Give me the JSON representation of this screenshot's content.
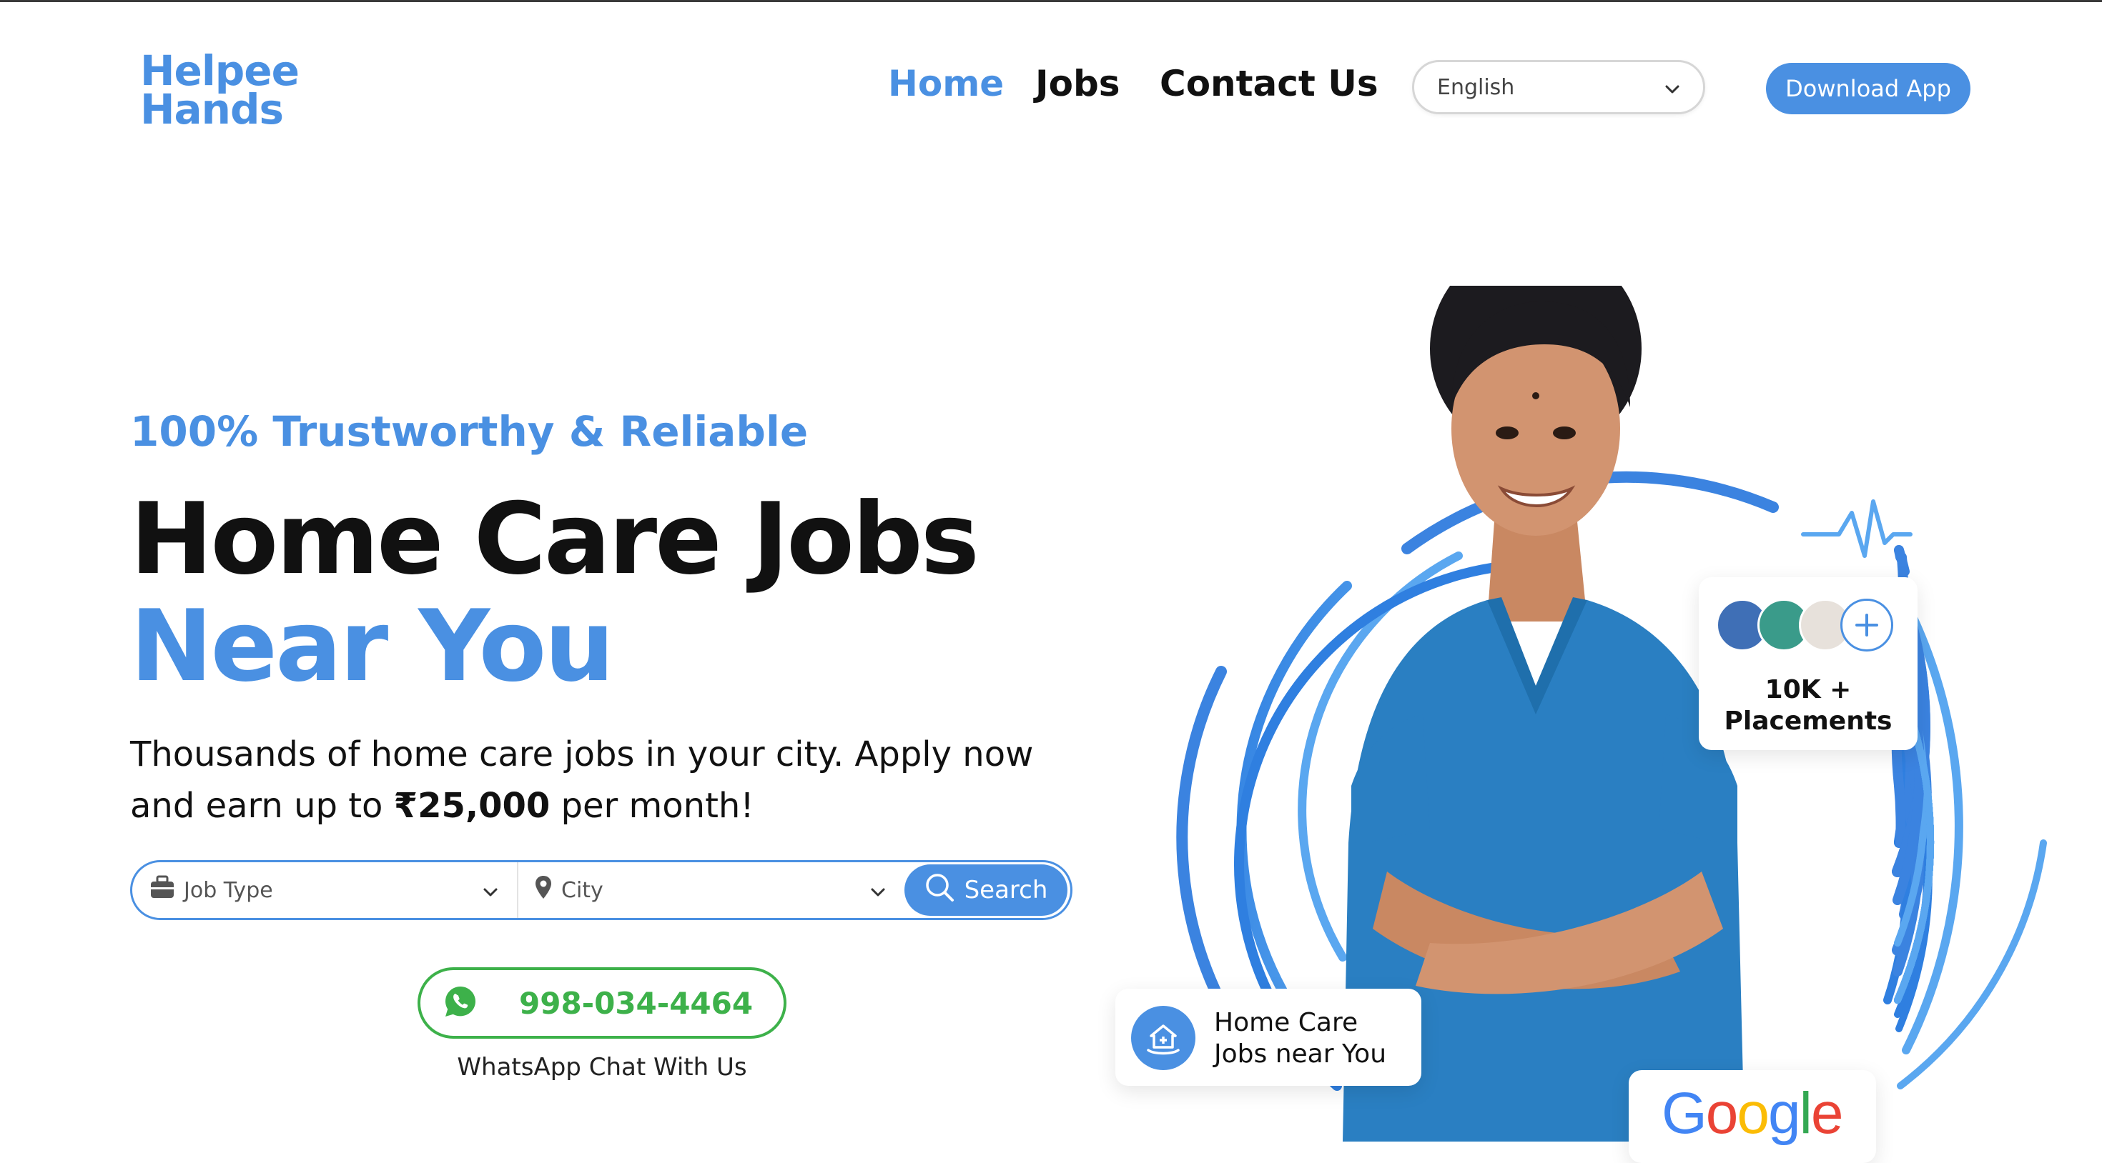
{
  "brand": {
    "line1": "Helpee",
    "line2": "Hands",
    "color": "#4a90e2"
  },
  "nav": {
    "items": [
      {
        "label": "Home",
        "active": true
      },
      {
        "label": "Jobs",
        "active": false
      },
      {
        "label": "Contact Us",
        "active": false
      }
    ],
    "language": {
      "selected": "English"
    },
    "download_label": "Download App"
  },
  "hero": {
    "tagline": "100% Trustworthy & Reliable",
    "title_line1": "Home Care Jobs",
    "title_line2": "Near You",
    "description_before": "Thousands of home care jobs in your city. Apply now and earn up to ",
    "description_amount": "₹25,000",
    "description_after": " per month!"
  },
  "search": {
    "job_type_placeholder": "Job Type",
    "city_placeholder": "City",
    "button_label": "Search"
  },
  "whatsapp": {
    "number": "998-034-4464",
    "caption": "WhatsApp Chat With Us",
    "color": "#3db14a"
  },
  "badges": {
    "placements_line1": "10K +",
    "placements_line2": "Placements",
    "home_care_line1": "Home Care",
    "home_care_line2": "Jobs near You",
    "google_text": "Google"
  },
  "icons": [
    "chevron-down-icon",
    "briefcase-icon",
    "location-pin-icon",
    "search-icon",
    "whatsapp-icon",
    "plus-icon",
    "heartbeat-icon",
    "home-care-icon"
  ],
  "colors": {
    "accent": "#4a90e2",
    "whatsapp_green": "#3db14a",
    "scrubs_blue": "#2a7fc2"
  }
}
